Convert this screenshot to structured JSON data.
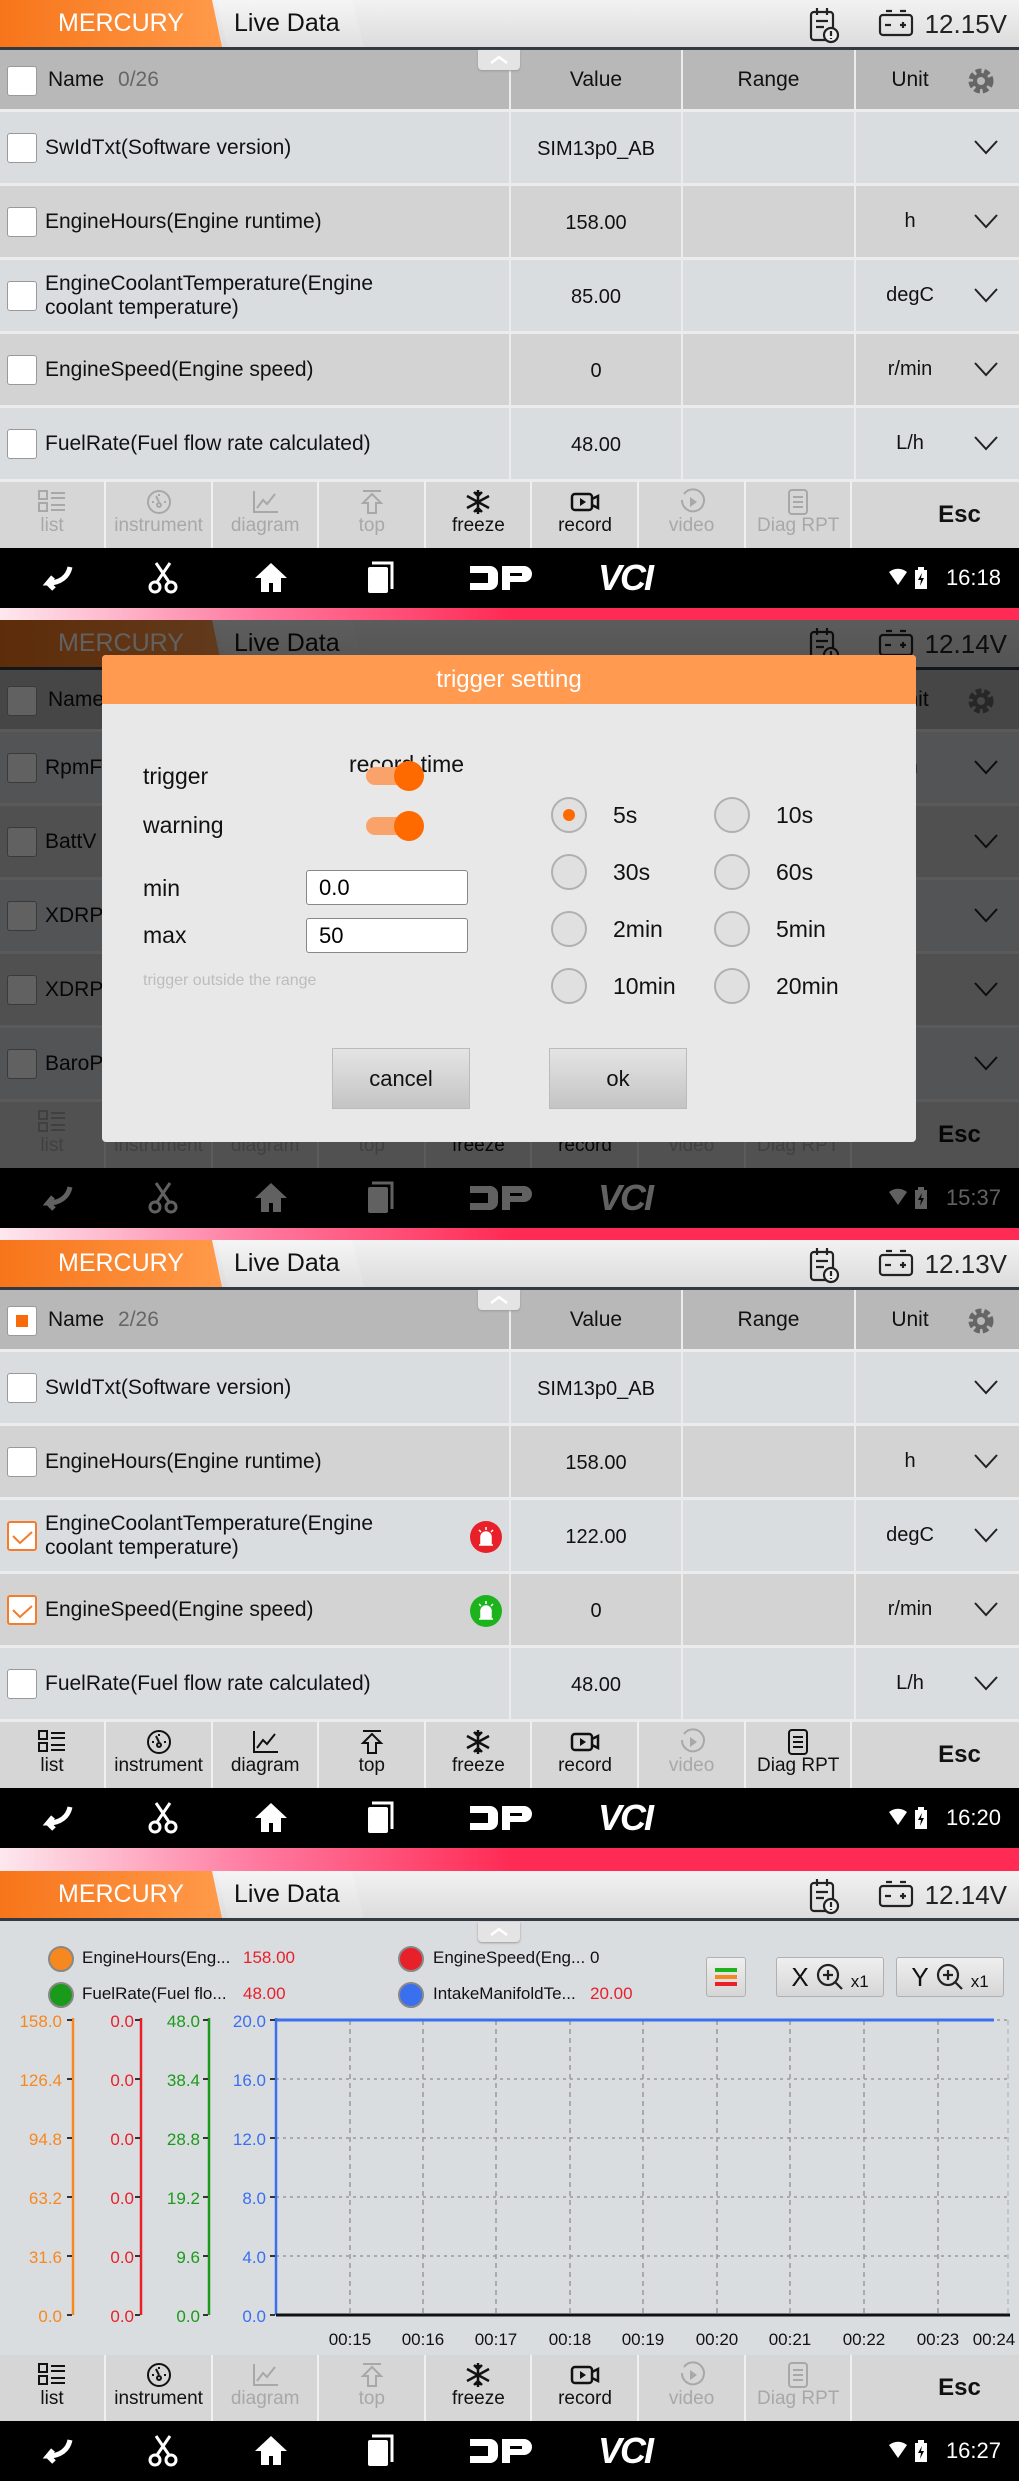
{
  "screens": [
    {
      "header": {
        "brand_tab": "MERCURY",
        "section_tab": "Live Data",
        "voltage": "12.15V"
      },
      "table": {
        "headers": {
          "name": "Name",
          "count": "0/26",
          "value": "Value",
          "range": "Range",
          "unit": "Unit"
        },
        "select_all_state": "unchecked",
        "rows": [
          {
            "name": "SwIdTxt(Software version)",
            "value": "SIM13p0_AB",
            "range": "",
            "unit": "",
            "checked": false
          },
          {
            "name": "EngineHours(Engine runtime)",
            "value": "158.00",
            "range": "",
            "unit": "h",
            "checked": false
          },
          {
            "name": "EngineCoolantTemperature(Engine coolant temperature)",
            "value": "85.00",
            "range": "",
            "unit": "degC",
            "checked": false
          },
          {
            "name": "EngineSpeed(Engine speed)",
            "value": "0",
            "range": "",
            "unit": "r/min",
            "checked": false
          },
          {
            "name": "FuelRate(Fuel flow rate calculated)",
            "value": "48.00",
            "range": "",
            "unit": "L/h",
            "checked": false
          }
        ]
      },
      "toolbar_enabled": [
        "freeze",
        "record"
      ],
      "clock": "16:18"
    },
    {
      "header": {
        "brand_tab": "MERCURY",
        "section_tab": "Live Data",
        "voltage": "12.14V"
      },
      "table": {
        "headers": {
          "name": "Name",
          "count": "",
          "value": "Value",
          "range": "Range",
          "unit": "Unit"
        },
        "select_all_state": "unchecked",
        "rows": [
          {
            "name": "RpmF",
            "value": "",
            "range": "",
            "unit": "in",
            "checked": false
          },
          {
            "name": "BattV",
            "value": "",
            "range": "",
            "unit": "",
            "checked": false
          },
          {
            "name": "XDRP",
            "value": "",
            "range": "",
            "unit": "",
            "checked": false
          },
          {
            "name": "XDRP",
            "value": "",
            "range": "",
            "unit": "",
            "checked": false
          },
          {
            "name": "BaroP",
            "value": "",
            "range": "",
            "unit": "a",
            "checked": false
          }
        ]
      },
      "toolbar_enabled": [
        "freeze",
        "record"
      ],
      "clock": "15:37",
      "dialog": {
        "title": "trigger setting",
        "trigger_label": "trigger",
        "trigger_on": true,
        "warning_label": "warning",
        "warning_on": true,
        "min_label": "min",
        "min_value": "0.0",
        "max_label": "max",
        "max_value": "50",
        "hint": "trigger outside the range",
        "record_time_label": "record time",
        "record_options": [
          "5s",
          "10s",
          "30s",
          "60s",
          "2min",
          "5min",
          "10min",
          "20min"
        ],
        "record_selected": "5s",
        "cancel": "cancel",
        "ok": "ok"
      }
    },
    {
      "header": {
        "brand_tab": "MERCURY",
        "section_tab": "Live Data",
        "voltage": "12.13V"
      },
      "table": {
        "headers": {
          "name": "Name",
          "count": "2/26",
          "value": "Value",
          "range": "Range",
          "unit": "Unit"
        },
        "select_all_state": "partial",
        "rows": [
          {
            "name": "SwIdTxt(Software version)",
            "value": "SIM13p0_AB",
            "range": "",
            "unit": "",
            "checked": false
          },
          {
            "name": "EngineHours(Engine runtime)",
            "value": "158.00",
            "range": "",
            "unit": "h",
            "checked": false
          },
          {
            "name": "EngineCoolantTemperature(Engine coolant temperature)",
            "value": "122.00",
            "range": "",
            "unit": "degC",
            "checked": true,
            "alarm": "red"
          },
          {
            "name": "EngineSpeed(Engine speed)",
            "value": "0",
            "range": "",
            "unit": "r/min",
            "checked": true,
            "alarm": "green"
          },
          {
            "name": "FuelRate(Fuel flow rate calculated)",
            "value": "48.00",
            "range": "",
            "unit": "L/h",
            "checked": false
          }
        ]
      },
      "toolbar_enabled": [
        "list",
        "instrument",
        "diagram",
        "top",
        "freeze",
        "record",
        "diag_rpt"
      ],
      "clock": "16:20"
    },
    {
      "header": {
        "brand_tab": "MERCURY",
        "section_tab": "Live Data",
        "voltage": "12.14V"
      },
      "zoom_x": {
        "axis": "X",
        "factor": "x1"
      },
      "zoom_y": {
        "axis": "Y",
        "factor": "x1"
      },
      "toolbar_enabled": [
        "list",
        "instrument",
        "freeze",
        "record"
      ],
      "clock": "16:27"
    }
  ],
  "toolbar": [
    {
      "id": "list",
      "label": "list",
      "icon": "list-icon"
    },
    {
      "id": "instrument",
      "label": "instrument",
      "icon": "gauge-icon"
    },
    {
      "id": "diagram",
      "label": "diagram",
      "icon": "line-chart-icon"
    },
    {
      "id": "top",
      "label": "top",
      "icon": "arrow-up-icon"
    },
    {
      "id": "freeze",
      "label": "freeze",
      "icon": "snowflake-icon"
    },
    {
      "id": "record",
      "label": "record",
      "icon": "video-camera-icon"
    },
    {
      "id": "video",
      "label": "video",
      "icon": "play-icon"
    },
    {
      "id": "diag_rpt",
      "label": "Diag RPT",
      "icon": "report-icon"
    }
  ],
  "esc_label": "Esc",
  "nav": {
    "dp_label": "DP",
    "vci_label": "VCI"
  },
  "colors": {
    "accent": "#f7751a",
    "alarm_red": "#e8202a",
    "alarm_green": "#1db31d",
    "pink_strip": "#ff2b55"
  },
  "chart_data": {
    "type": "line",
    "x": [
      "00:15",
      "00:16",
      "00:17",
      "00:18",
      "00:19",
      "00:20",
      "00:21",
      "00:22",
      "00:23",
      "00:24"
    ],
    "grid": true,
    "legend_placement": "top",
    "series": [
      {
        "name": "EngineHours(Eng...",
        "current": "158.00",
        "color": "#f7871f",
        "ylim": [
          0,
          158.0
        ],
        "yticks": [
          "0.0",
          "31.6",
          "63.2",
          "94.8",
          "126.4",
          "158.0"
        ],
        "values": [
          158,
          158,
          158,
          158,
          158,
          158,
          158,
          158,
          158,
          158
        ]
      },
      {
        "name": "EngineSpeed(Eng...",
        "current": "0",
        "color": "#e8202a",
        "ylim": [
          0,
          0
        ],
        "yticks": [
          "0.0",
          "0.0",
          "0.0",
          "0.0",
          "0.0",
          "0.0"
        ],
        "values": [
          0,
          0,
          0,
          0,
          0,
          0,
          0,
          0,
          0,
          0
        ]
      },
      {
        "name": "FuelRate(Fuel flo...",
        "current": "48.00",
        "color": "#1a9a1a",
        "ylim": [
          0,
          48.0
        ],
        "yticks": [
          "0.0",
          "9.6",
          "19.2",
          "28.8",
          "38.4",
          "48.0"
        ],
        "values": [
          48,
          48,
          48,
          48,
          48,
          48,
          48,
          48,
          48,
          48
        ]
      },
      {
        "name": "IntakeManifoldTe...",
        "current": "20.00",
        "color": "#3a6ff0",
        "ylim": [
          0,
          20.0
        ],
        "yticks": [
          "0.0",
          "4.0",
          "8.0",
          "12.0",
          "16.0",
          "20.0"
        ],
        "values": [
          20,
          20,
          20,
          20,
          20,
          20,
          20,
          20,
          20,
          20
        ]
      }
    ]
  }
}
